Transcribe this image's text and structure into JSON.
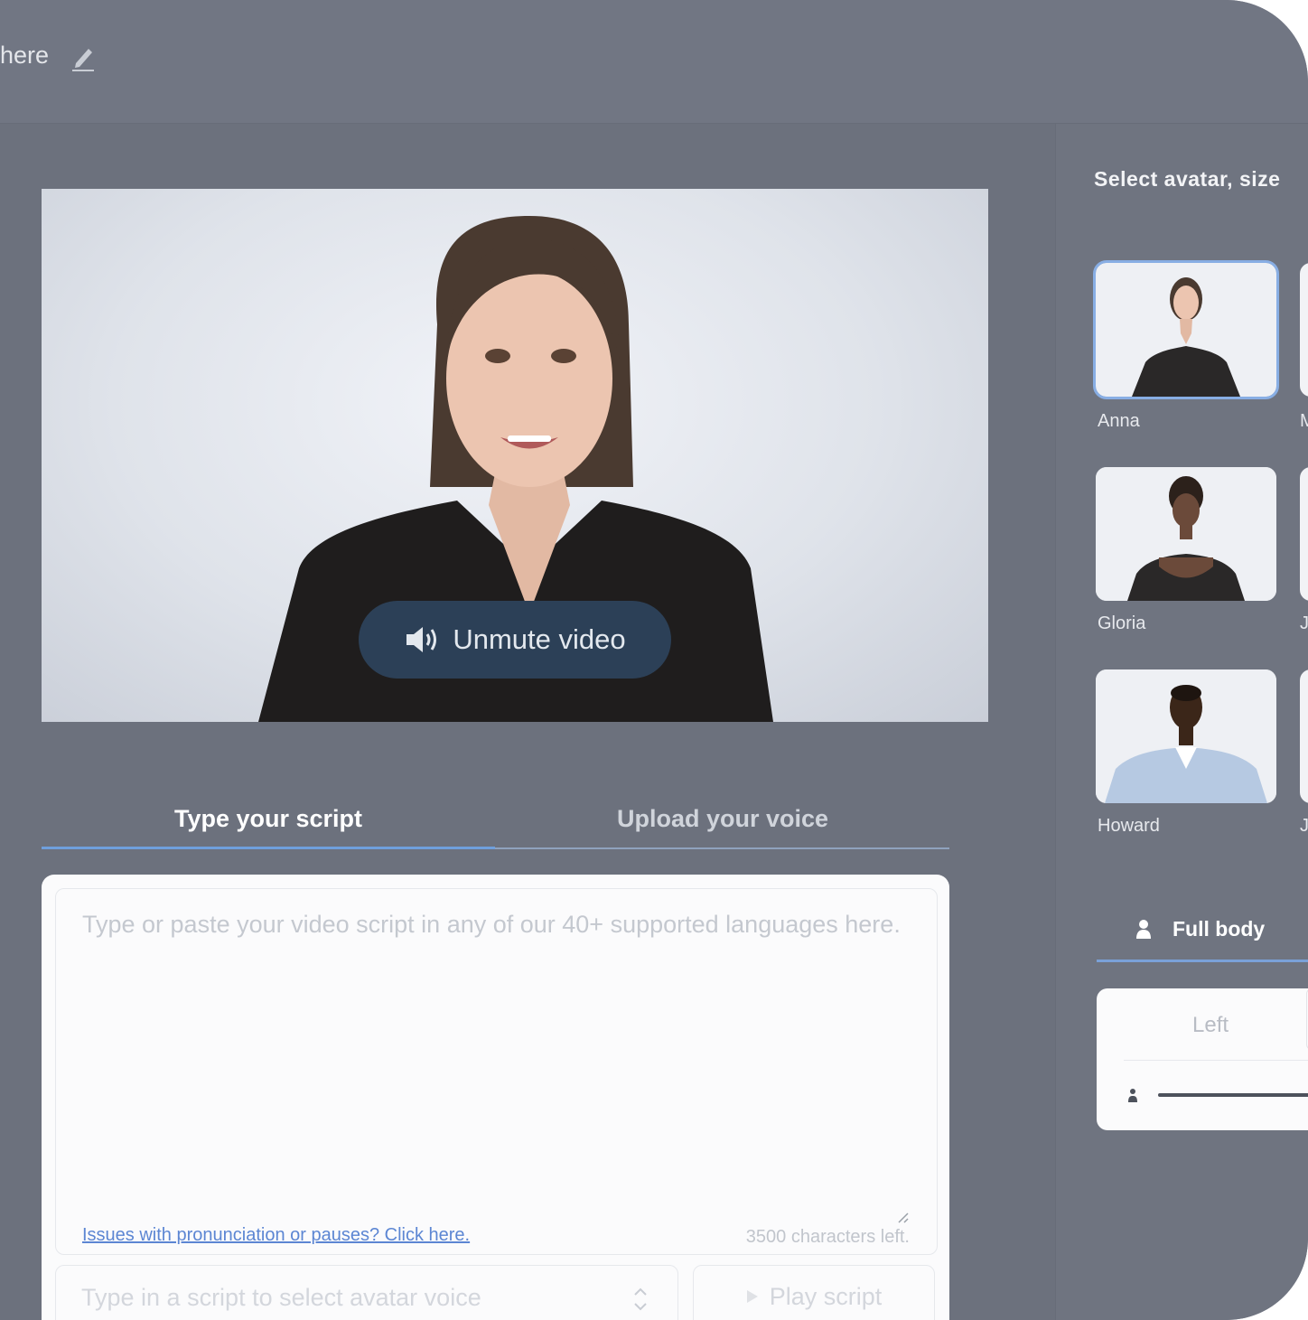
{
  "header": {
    "title": "here"
  },
  "video": {
    "unmute_label": "Unmute video"
  },
  "tabs": [
    {
      "label": "Type your script"
    },
    {
      "label": "Upload your voice"
    }
  ],
  "script": {
    "placeholder": "Type or paste your video script in any of our 40+ supported languages here.",
    "issues_link": "Issues with pronunciation or pauses? Click here.",
    "chars_left": "3500 characters left.",
    "voice_placeholder": "Type in a script to select avatar voice",
    "play_label": "Play script"
  },
  "sidebar": {
    "title": "Select avatar, size",
    "avatars": [
      {
        "name": "Anna",
        "selected": true
      },
      {
        "name": "M",
        "partial": true
      },
      {
        "name": "Gloria"
      },
      {
        "name": "J",
        "partial": true
      },
      {
        "name": "Howard"
      },
      {
        "name": "J",
        "partial": true
      }
    ],
    "size_tab": "Full body",
    "position_left": "Left"
  },
  "colors": {
    "accent": "#6f9fdc",
    "unmute_bg": "#2c4057",
    "link": "#5c86d3"
  }
}
